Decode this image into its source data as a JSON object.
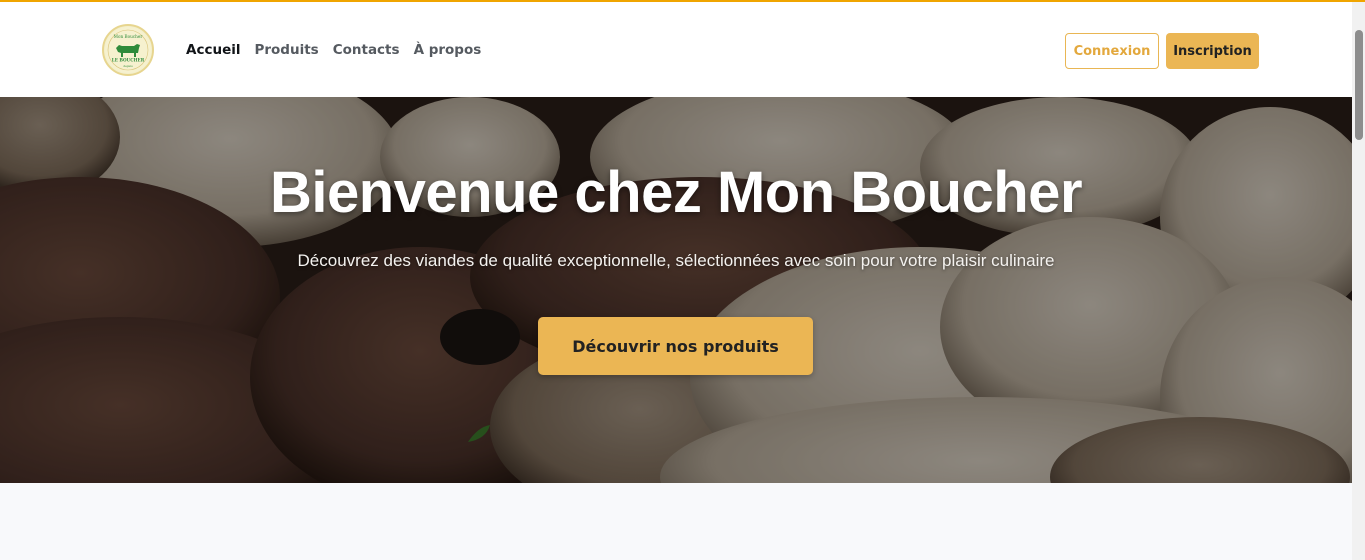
{
  "brand": {
    "logo_text_top": "Mon Boucher",
    "logo_text_mid": "LE BOUCHER",
    "logo_text_bottom": "depuis"
  },
  "nav": {
    "items": [
      {
        "label": "Accueil",
        "active": true
      },
      {
        "label": "Produits",
        "active": false
      },
      {
        "label": "Contacts",
        "active": false
      },
      {
        "label": "À propos",
        "active": false
      }
    ]
  },
  "auth": {
    "login_label": "Connexion",
    "signup_label": "Inscription"
  },
  "hero": {
    "title": "Bienvenue chez Mon Boucher",
    "subtitle": "Découvrez des viandes de qualité exceptionnelle, sélectionnées avec soin pour votre plaisir culinaire",
    "cta_label": "Découvrir nos produits"
  },
  "colors": {
    "accent": "#ebb654",
    "top_bar": "#f0a500"
  }
}
